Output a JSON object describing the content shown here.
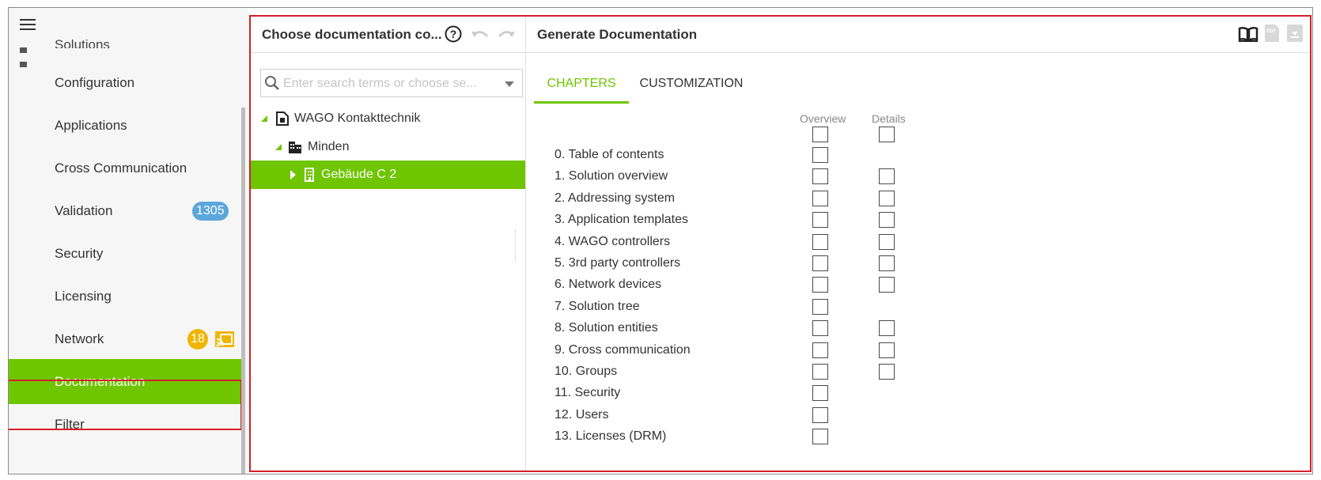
{
  "sidebar": {
    "peek_label": "Solutions",
    "items": [
      {
        "label": "Configuration"
      },
      {
        "label": "Applications"
      },
      {
        "label": "Cross Communication"
      },
      {
        "label": "Validation",
        "badge": "1305"
      },
      {
        "label": "Security"
      },
      {
        "label": "Licensing"
      },
      {
        "label": "Network",
        "badge": "18"
      },
      {
        "label": "Documentation",
        "active": true
      },
      {
        "label": "Filter"
      }
    ],
    "colors": {
      "active": "#6fc500",
      "badge_blue": "#5ba7dc",
      "badge_yellow": "#f0b500"
    }
  },
  "left_panel": {
    "title": "Choose documentation co...",
    "search": {
      "placeholder": "Enter search terms or choose se...",
      "value": ""
    },
    "tree": [
      {
        "label": "WAGO Kontakttechnik",
        "icon": "building-doc-icon",
        "expanded": true
      },
      {
        "label": "Minden",
        "icon": "city-icon",
        "expanded": true
      },
      {
        "label": "Gebäude C 2",
        "icon": "building-icon",
        "selected": true
      }
    ]
  },
  "right_panel": {
    "title": "Generate Documentation",
    "tabs": [
      {
        "label": "CHAPTERS",
        "active": true
      },
      {
        "label": "CUSTOMIZATION"
      }
    ],
    "columns": {
      "overview": "Overview",
      "details": "Details"
    },
    "chapters": [
      {
        "label": "0. Table of contents",
        "details": false
      },
      {
        "label": "1. Solution overview",
        "details": true
      },
      {
        "label": "2. Addressing system",
        "details": true
      },
      {
        "label": "3. Application templates",
        "details": true
      },
      {
        "label": "4. WAGO controllers",
        "details": true
      },
      {
        "label": "5. 3rd party controllers",
        "details": true
      },
      {
        "label": "6. Network devices",
        "details": true
      },
      {
        "label": "7. Solution tree",
        "details": false
      },
      {
        "label": "8. Solution entities",
        "details": true
      },
      {
        "label": "9. Cross communication",
        "details": true
      },
      {
        "label": "10. Groups",
        "details": true
      },
      {
        "label": "11. Security",
        "details": false
      },
      {
        "label": "12. Users",
        "details": false
      },
      {
        "label": "13. Licenses (DRM)",
        "details": false
      }
    ]
  }
}
